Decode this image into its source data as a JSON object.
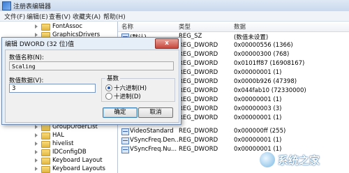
{
  "window": {
    "title": "注册表编辑器",
    "icon": "registry-editor-icon"
  },
  "menu": [
    "文件(F)",
    "编辑(E)",
    "查看(V)",
    "收藏夹(A)",
    "帮助(H)"
  ],
  "tree": {
    "items": [
      "FontAssoc",
      "GraphicsDrivers",
      "GroupOrderList",
      "HAL",
      "hivelist",
      "IDConfigDB",
      "Keyboard Layout",
      "Keyboard Layouts"
    ]
  },
  "list": {
    "headers": {
      "name": "名称",
      "type": "类型",
      "data": "数据"
    },
    "rows": [
      {
        "name": "(默认)",
        "type": "REG_SZ",
        "data": "(数值未设置)"
      },
      {
        "name": "",
        "type": "REG_DWORD",
        "data": "0x00000556 (1366)"
      },
      {
        "name": "",
        "type": "REG_DWORD",
        "data": "0x00000300 (768)"
      },
      {
        "name": "",
        "type": "REG_DWORD",
        "data": "0x0101ff87 (16908167)"
      },
      {
        "name": "",
        "type": "REG_DWORD",
        "data": "0x00000001 (1)"
      },
      {
        "name": "",
        "type": "REG_DWORD",
        "data": "0x0000b926 (47398)"
      },
      {
        "name": "",
        "type": "REG_DWORD",
        "data": "0x044fab10 (72330000)"
      },
      {
        "name": "",
        "type": "REG_DWORD",
        "data": "0x00000001 (1)"
      },
      {
        "name": "",
        "type": "REG_DWORD",
        "data": "0x00000003 (3)"
      },
      {
        "name": "",
        "type": "REG_DWORD",
        "data": "0x00000001 (1)"
      },
      {
        "name": "VideoStandard",
        "type": "REG_DWORD",
        "data": "0x000000ff (255)"
      },
      {
        "name": "VSyncFreq.Den...",
        "type": "REG_DWORD",
        "data": "0x00000001 (1)"
      },
      {
        "name": "VSyncFreq.Nu...",
        "type": "REG_DWORD",
        "data": "0x00000001 (1)"
      }
    ]
  },
  "dialog": {
    "title": "编辑 DWORD (32 位)值",
    "close": "x",
    "value_name_label": "数值名称(N):",
    "value_name": "Scaling",
    "value_data_label": "数值数据(V):",
    "value_data": "3",
    "base_label": "基数",
    "hex_label": "十六进制(H)",
    "dec_label": "十进制(D)",
    "ok": "确定",
    "cancel": "取消"
  },
  "watermark": {
    "text": "系统之家"
  }
}
